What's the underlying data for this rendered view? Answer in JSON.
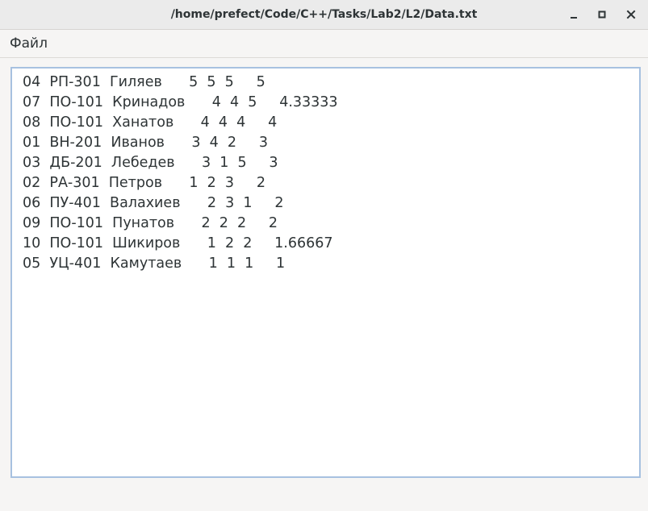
{
  "window": {
    "title": "/home/prefect/Code/C++/Tasks/Lab2/L2/Data.txt"
  },
  "menu": {
    "items": [
      {
        "label": "Файл"
      }
    ]
  },
  "text_view": {
    "lines": [
      "04  РП-301  Гиляев      5  5  5     5",
      "07  ПО-101  Кринадов      4  4  5     4.33333",
      "08  ПО-101  Ханатов      4  4  4     4",
      "01  ВН-201  Иванов      3  4  2     3",
      "03  ДБ-201  Лебедев      3  1  5     3",
      "02  РА-301  Петров      1  2  3     2",
      "06  ПУ-401  Валахиев      2  3  1     2",
      "09  ПО-101  Пунатов      2  2  2     2",
      "10  ПО-101  Шикиров      1  2  2     1.66667",
      "05  УЦ-401  Камутаев      1  1  1     1"
    ]
  },
  "icons": {
    "minimize": "minimize-icon",
    "maximize": "maximize-icon",
    "close": "close-icon"
  }
}
